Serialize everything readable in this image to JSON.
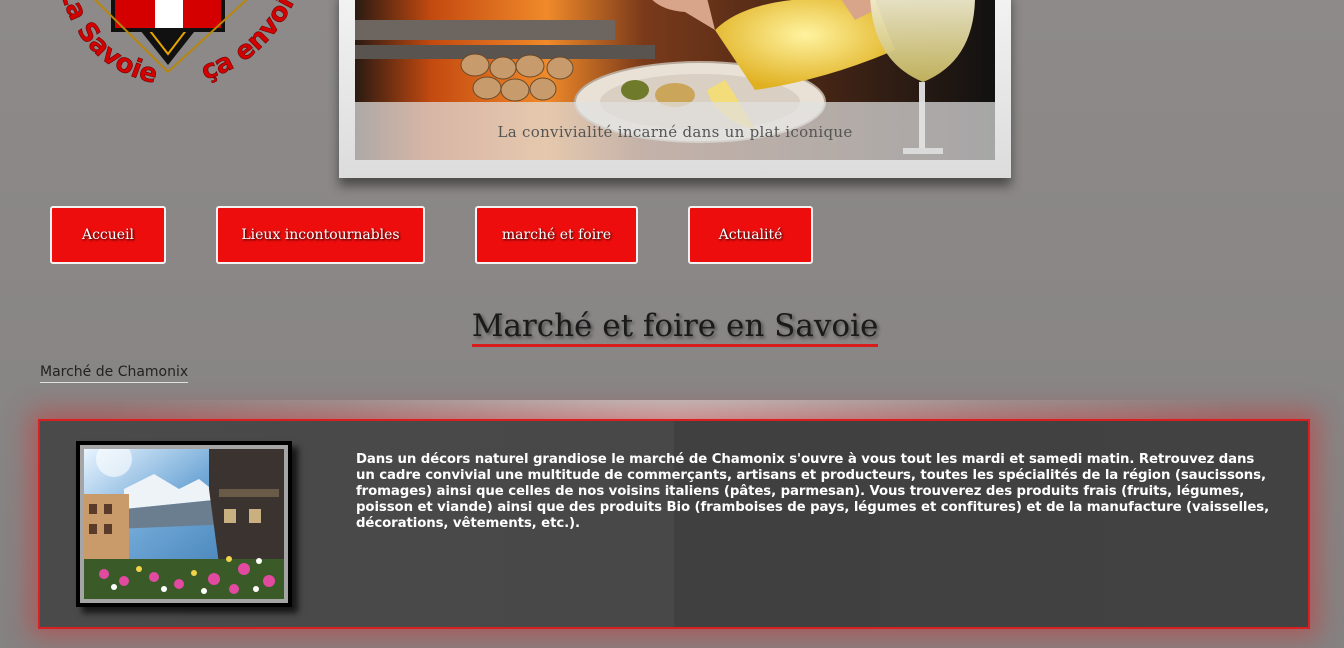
{
  "logo": {
    "text_left": "La Savoie",
    "text_right": "ça envoie"
  },
  "slider": {
    "caption": "La convivialité incarné dans un plat iconique"
  },
  "nav": {
    "items": [
      {
        "label": "Accueil"
      },
      {
        "label": "Lieux incontournables"
      },
      {
        "label": "marché et foire"
      },
      {
        "label": "Actualité"
      }
    ]
  },
  "page": {
    "title": "Marché et foire en Savoie",
    "section_link": "Marché de Chamonix"
  },
  "card": {
    "text": "Dans un décors naturel grandiose le marché de Chamonix s'ouvre à vous tout les mardi et samedi matin. Retrouvez dans un cadre convivial une multitude de commerçants, artisans et producteurs, toutes les spécialités de la région (saucissons, fromages) ainsi que celles de nos voisins italiens (pâtes, parmesan). Vous trouverez des produits frais (fruits, légumes, poisson et viande) ainsi que des produits Bio (framboises de pays, légumes et confitures) et de la manufacture (vaisselles, décorations, vêtements, etc.)."
  },
  "colors": {
    "accent": "#ee0d0d",
    "background": "#8a8787",
    "card_bg": "#444444"
  }
}
